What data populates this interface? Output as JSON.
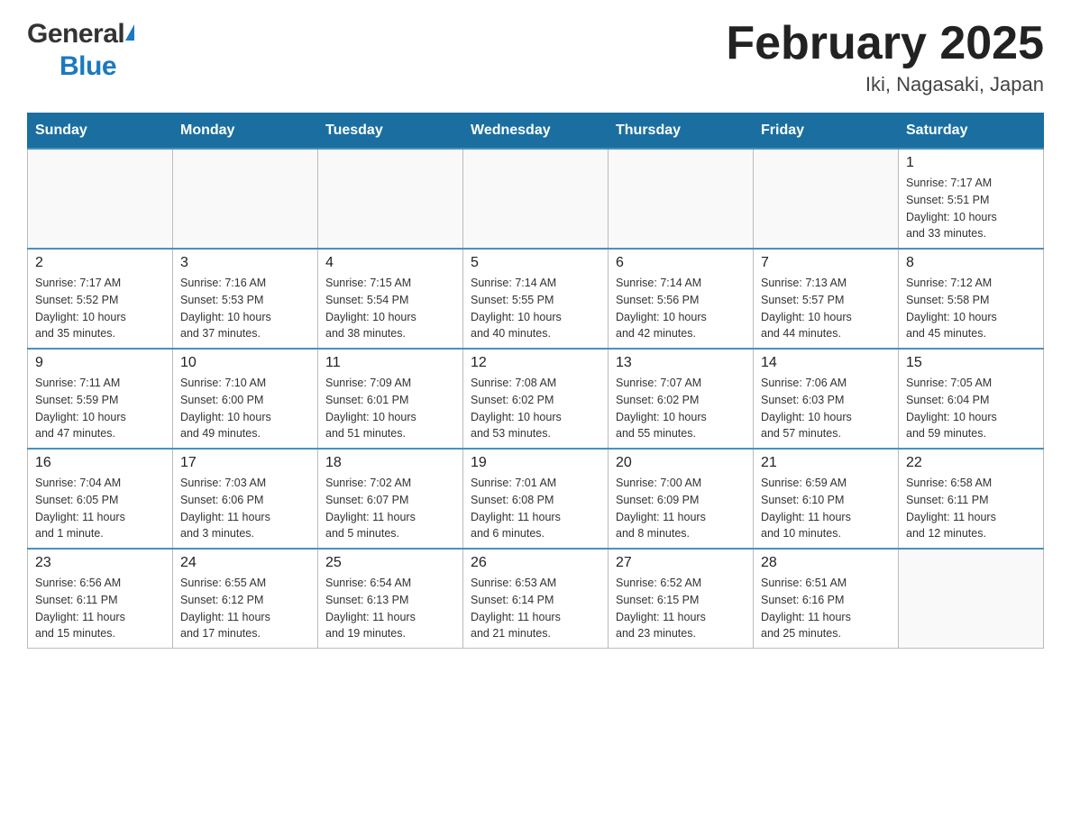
{
  "header": {
    "logo_general": "General",
    "logo_blue": "Blue",
    "title": "February 2025",
    "location": "Iki, Nagasaki, Japan"
  },
  "days_of_week": [
    "Sunday",
    "Monday",
    "Tuesday",
    "Wednesday",
    "Thursday",
    "Friday",
    "Saturday"
  ],
  "weeks": [
    [
      {
        "day": "",
        "info": ""
      },
      {
        "day": "",
        "info": ""
      },
      {
        "day": "",
        "info": ""
      },
      {
        "day": "",
        "info": ""
      },
      {
        "day": "",
        "info": ""
      },
      {
        "day": "",
        "info": ""
      },
      {
        "day": "1",
        "info": "Sunrise: 7:17 AM\nSunset: 5:51 PM\nDaylight: 10 hours\nand 33 minutes."
      }
    ],
    [
      {
        "day": "2",
        "info": "Sunrise: 7:17 AM\nSunset: 5:52 PM\nDaylight: 10 hours\nand 35 minutes."
      },
      {
        "day": "3",
        "info": "Sunrise: 7:16 AM\nSunset: 5:53 PM\nDaylight: 10 hours\nand 37 minutes."
      },
      {
        "day": "4",
        "info": "Sunrise: 7:15 AM\nSunset: 5:54 PM\nDaylight: 10 hours\nand 38 minutes."
      },
      {
        "day": "5",
        "info": "Sunrise: 7:14 AM\nSunset: 5:55 PM\nDaylight: 10 hours\nand 40 minutes."
      },
      {
        "day": "6",
        "info": "Sunrise: 7:14 AM\nSunset: 5:56 PM\nDaylight: 10 hours\nand 42 minutes."
      },
      {
        "day": "7",
        "info": "Sunrise: 7:13 AM\nSunset: 5:57 PM\nDaylight: 10 hours\nand 44 minutes."
      },
      {
        "day": "8",
        "info": "Sunrise: 7:12 AM\nSunset: 5:58 PM\nDaylight: 10 hours\nand 45 minutes."
      }
    ],
    [
      {
        "day": "9",
        "info": "Sunrise: 7:11 AM\nSunset: 5:59 PM\nDaylight: 10 hours\nand 47 minutes."
      },
      {
        "day": "10",
        "info": "Sunrise: 7:10 AM\nSunset: 6:00 PM\nDaylight: 10 hours\nand 49 minutes."
      },
      {
        "day": "11",
        "info": "Sunrise: 7:09 AM\nSunset: 6:01 PM\nDaylight: 10 hours\nand 51 minutes."
      },
      {
        "day": "12",
        "info": "Sunrise: 7:08 AM\nSunset: 6:02 PM\nDaylight: 10 hours\nand 53 minutes."
      },
      {
        "day": "13",
        "info": "Sunrise: 7:07 AM\nSunset: 6:02 PM\nDaylight: 10 hours\nand 55 minutes."
      },
      {
        "day": "14",
        "info": "Sunrise: 7:06 AM\nSunset: 6:03 PM\nDaylight: 10 hours\nand 57 minutes."
      },
      {
        "day": "15",
        "info": "Sunrise: 7:05 AM\nSunset: 6:04 PM\nDaylight: 10 hours\nand 59 minutes."
      }
    ],
    [
      {
        "day": "16",
        "info": "Sunrise: 7:04 AM\nSunset: 6:05 PM\nDaylight: 11 hours\nand 1 minute."
      },
      {
        "day": "17",
        "info": "Sunrise: 7:03 AM\nSunset: 6:06 PM\nDaylight: 11 hours\nand 3 minutes."
      },
      {
        "day": "18",
        "info": "Sunrise: 7:02 AM\nSunset: 6:07 PM\nDaylight: 11 hours\nand 5 minutes."
      },
      {
        "day": "19",
        "info": "Sunrise: 7:01 AM\nSunset: 6:08 PM\nDaylight: 11 hours\nand 6 minutes."
      },
      {
        "day": "20",
        "info": "Sunrise: 7:00 AM\nSunset: 6:09 PM\nDaylight: 11 hours\nand 8 minutes."
      },
      {
        "day": "21",
        "info": "Sunrise: 6:59 AM\nSunset: 6:10 PM\nDaylight: 11 hours\nand 10 minutes."
      },
      {
        "day": "22",
        "info": "Sunrise: 6:58 AM\nSunset: 6:11 PM\nDaylight: 11 hours\nand 12 minutes."
      }
    ],
    [
      {
        "day": "23",
        "info": "Sunrise: 6:56 AM\nSunset: 6:11 PM\nDaylight: 11 hours\nand 15 minutes."
      },
      {
        "day": "24",
        "info": "Sunrise: 6:55 AM\nSunset: 6:12 PM\nDaylight: 11 hours\nand 17 minutes."
      },
      {
        "day": "25",
        "info": "Sunrise: 6:54 AM\nSunset: 6:13 PM\nDaylight: 11 hours\nand 19 minutes."
      },
      {
        "day": "26",
        "info": "Sunrise: 6:53 AM\nSunset: 6:14 PM\nDaylight: 11 hours\nand 21 minutes."
      },
      {
        "day": "27",
        "info": "Sunrise: 6:52 AM\nSunset: 6:15 PM\nDaylight: 11 hours\nand 23 minutes."
      },
      {
        "day": "28",
        "info": "Sunrise: 6:51 AM\nSunset: 6:16 PM\nDaylight: 11 hours\nand 25 minutes."
      },
      {
        "day": "",
        "info": ""
      }
    ]
  ]
}
